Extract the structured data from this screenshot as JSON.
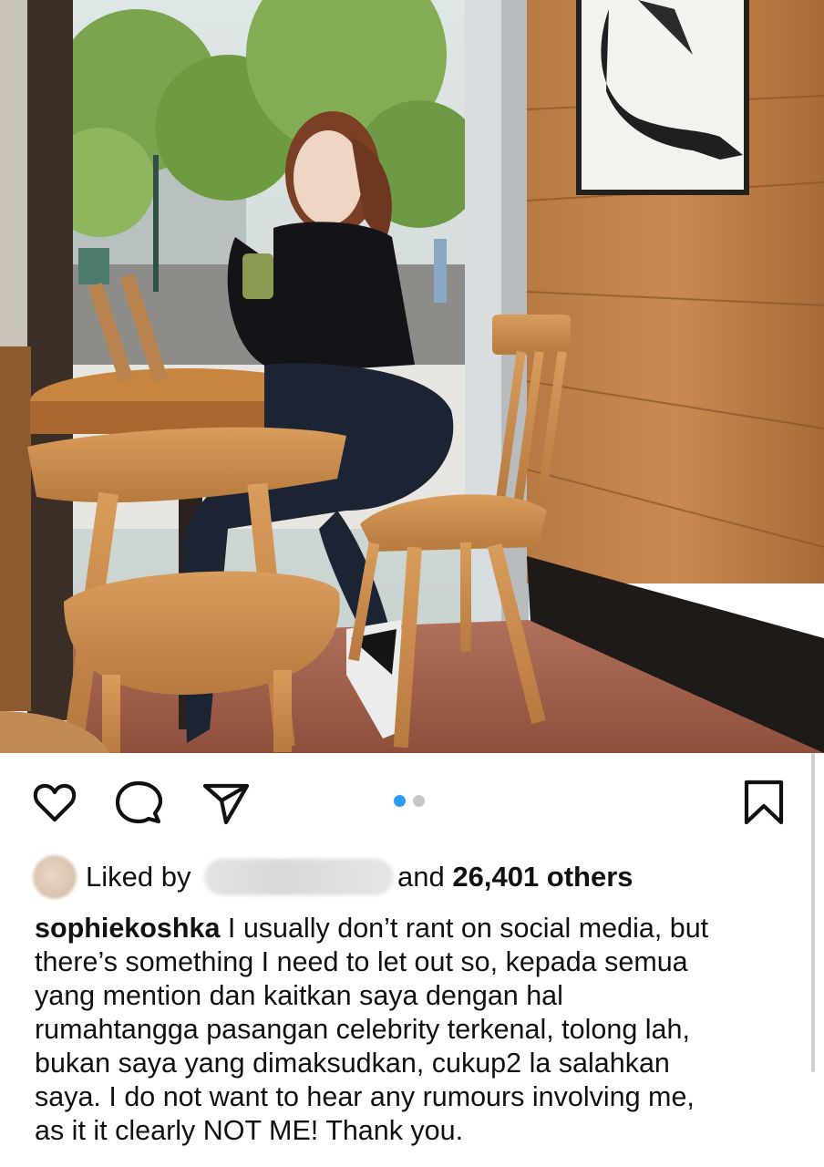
{
  "post": {
    "image_alt": "Woman sipping a drink at a wooden cafe table by the window",
    "carousel": {
      "total": 2,
      "current": 1
    }
  },
  "actions": {
    "like": "heart-icon",
    "comment": "comment-icon",
    "share": "send-icon",
    "save": "bookmark-icon"
  },
  "likes": {
    "prefix": "Liked by",
    "middle": "and",
    "count_text": "26,401 others"
  },
  "caption": {
    "username": "sophiekoshka",
    "lines": [
      " I usually don’t rant on social media, but",
      "there’s something I need to let out so, kepada  semua",
      "yang mention dan kaitkan saya dengan hal",
      "rumahtangga pasangan celebrity terkenal, tolong lah,",
      "bukan saya yang dimaksudkan, cukup2 la salahkan",
      "saya. I do not want to hear any rumours involving me,",
      "as it it clearly NOT ME! Thank you."
    ]
  },
  "colors": {
    "accent_dot": "#2b9cf2",
    "inactive_dot": "#c7c7c7",
    "text": "#111111"
  }
}
